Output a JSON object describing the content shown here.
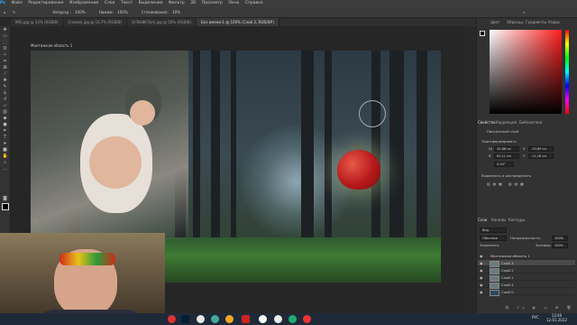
{
  "menu": [
    "Файл",
    "Редактирование",
    "Изображение",
    "Слои",
    "Текст",
    "Выделение",
    "Фильтр",
    "3D",
    "Просмотр",
    "Окно",
    "Справка"
  ],
  "options": {
    "opacity_label": "Непрозр.:",
    "opacity": "100%",
    "flow_label": "Нажим:",
    "flow": "100%",
    "smooth_label": "Сглаживание:",
    "smooth": "10%"
  },
  "tabs": [
    {
      "label": "IMG.jpg @ 33% (RGB/8)",
      "active": false
    },
    {
      "label": "Снимок.jpg @ 16,7% (RGB/8)",
      "active": false
    },
    {
      "label": "OrTeb8K?jkm.jpg @ 50% (RGB/8)",
      "active": false
    },
    {
      "label": "Без имени-1 @ 100% (Слой 3, RGB/8#)",
      "active": true
    }
  ],
  "artboard_label": "Монтажная область 1",
  "panels": {
    "color_tabs": [
      "Цвет",
      "Образцы",
      "Градиенты",
      "Узоры"
    ],
    "props_tabs": [
      "Свойства",
      "Коррекция",
      "Библиотеки"
    ],
    "pixel_layer": "Пиксельный слой",
    "transform_title": "Трансформировать",
    "w_label": "Ш",
    "w": "40,88 см",
    "h_label": "В",
    "h": "62,11 см",
    "x_label": "X",
    "x": "-10,89 см",
    "y_label": "Y",
    "y": "-11,26 см",
    "angle": "0,00°",
    "align_title": "Выровнять и распределить",
    "layers_tabs": [
      "Слои",
      "Каналы",
      "Контуры"
    ],
    "filter_label": "Вид",
    "blend_mode": "Обычные",
    "opacity_label": "Непрозрачность:",
    "opacity": "100%",
    "lock_label": "Закрепить:",
    "fill_label": "Заливка:",
    "fill": "100%"
  },
  "layers": [
    {
      "name": "Монтажная область 1",
      "selected": false
    },
    {
      "name": "Слой 3",
      "selected": true
    },
    {
      "name": "Слой 2",
      "selected": false
    },
    {
      "name": "Слой 1",
      "selected": false
    },
    {
      "name": "Слой 4",
      "selected": false
    },
    {
      "name": "Слой 0",
      "selected": false
    }
  ],
  "status": {
    "zoom": "100%",
    "doc": "Док: 2,49М/12,2М"
  },
  "taskbar": {
    "lang": "РУС",
    "time": "13:40",
    "date": "12.01.2022"
  }
}
